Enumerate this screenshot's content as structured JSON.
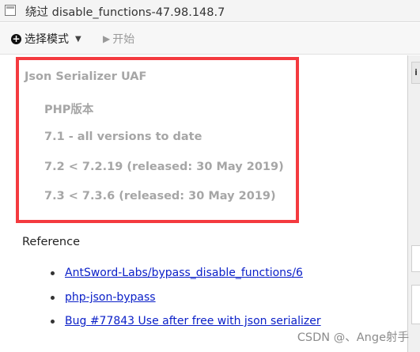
{
  "window": {
    "title": "绕过 disable_functions-47.98.148.7"
  },
  "toolbar": {
    "mode_label": "选择模式",
    "start_label": "开始"
  },
  "highlight": {
    "heading": "Json Serializer UAF",
    "php_version_label": "PHP版本",
    "versions": [
      "7.1 - all versions to date",
      "7.2 < 7.2.19 (released: 30 May 2019)",
      "7.3 < 7.3.6 (released: 30 May 2019)"
    ]
  },
  "reference": {
    "heading": "Reference",
    "links": [
      "AntSword-Labs/bypass_disable_functions/6",
      "php-json-bypass",
      "Bug #77843 Use after free with json serializer"
    ]
  },
  "right_panel": {
    "tab_label": "i"
  },
  "watermark": "CSDN @、Ange射手",
  "colors": {
    "highlight_border": "#f43a3f",
    "link": "#0b20c8",
    "gray_text": "#a6a6a6"
  }
}
